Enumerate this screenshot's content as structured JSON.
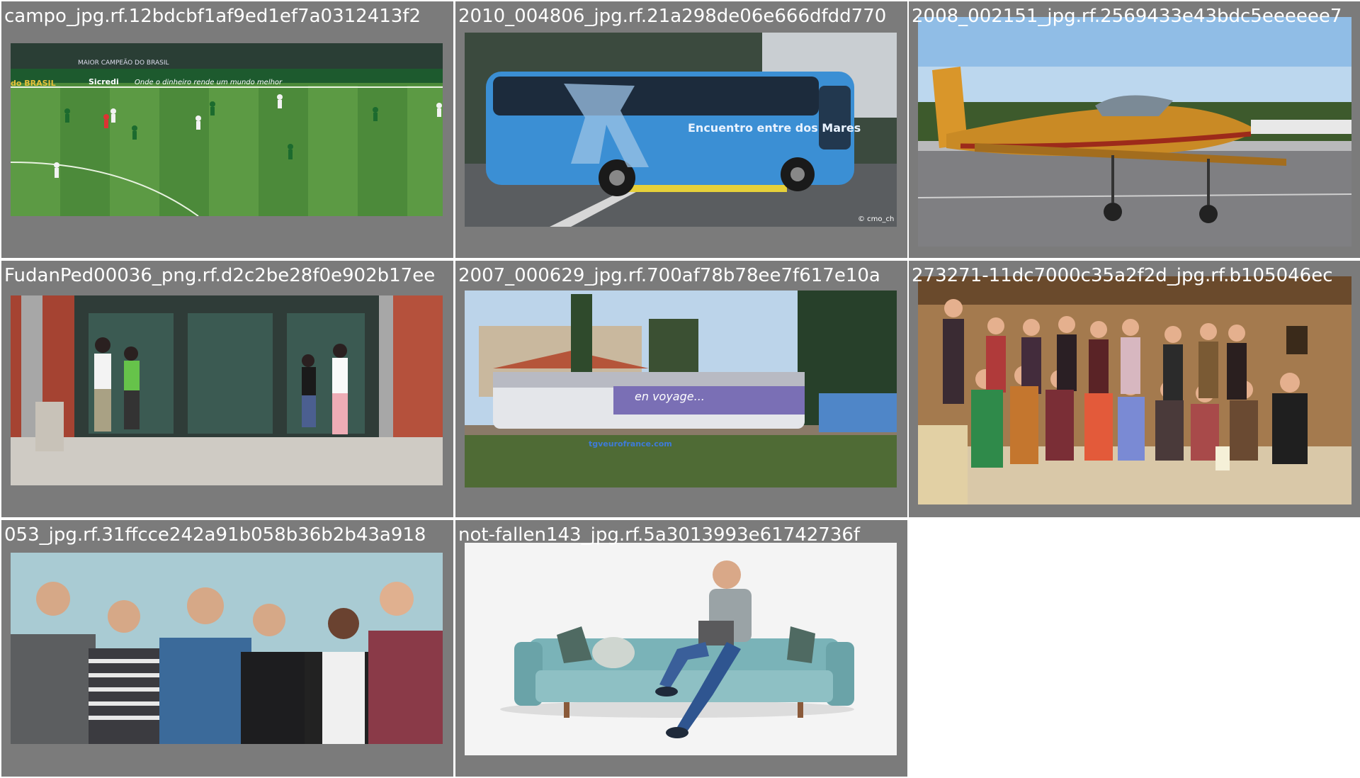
{
  "grid": {
    "cells": [
      {
        "caption": "campo_jpg.rf.12bdcbf1af9ed1ef7a0312413f2",
        "scene": "soccer-field-thumbnail",
        "banner_1": "MAIOR CAMPEÃO DO BRASIL",
        "banner_2": "Sicredi",
        "banner_3": "Onde o dinheiro rende um mundo melhor",
        "banner_4": "do BRASIL"
      },
      {
        "caption": "2010_004806_jpg.rf.21a298de06e666dfdd770",
        "scene": "blue-bus-thumbnail",
        "bus_text": "Encuentro entre dos Mares",
        "watermark": "© cmo_ch"
      },
      {
        "caption": "2008_002151_jpg.rf.2569433e43bdc5eeeeee7",
        "scene": "small-airplane-thumbnail"
      },
      {
        "caption": "FudanPed00036_png.rf.d2c2be28f0e902b17ee",
        "scene": "pedestrians-building-thumbnail"
      },
      {
        "caption": "2007_000629_jpg.rf.700af78b78ee7f617e10a",
        "scene": "train-thumbnail",
        "train_text": "en voyage...",
        "train_site": "tgveurofrance.com"
      },
      {
        "caption": "273271-11dc7000c35a2f2d_jpg.rf.b105046ec",
        "scene": "group-women-thumbnail"
      },
      {
        "caption": "053_jpg.rf.31ffcce242a91b058b36b2b43a918",
        "scene": "six-people-thumbnail"
      },
      {
        "caption": "not-fallen143_jpg.rf.5a3013993e61742736f",
        "scene": "man-on-sofa-thumbnail"
      }
    ]
  },
  "colors": {
    "cell_bg": "#7b7b7b",
    "caption": "#ffffff",
    "page_bg": "#ffffff"
  }
}
